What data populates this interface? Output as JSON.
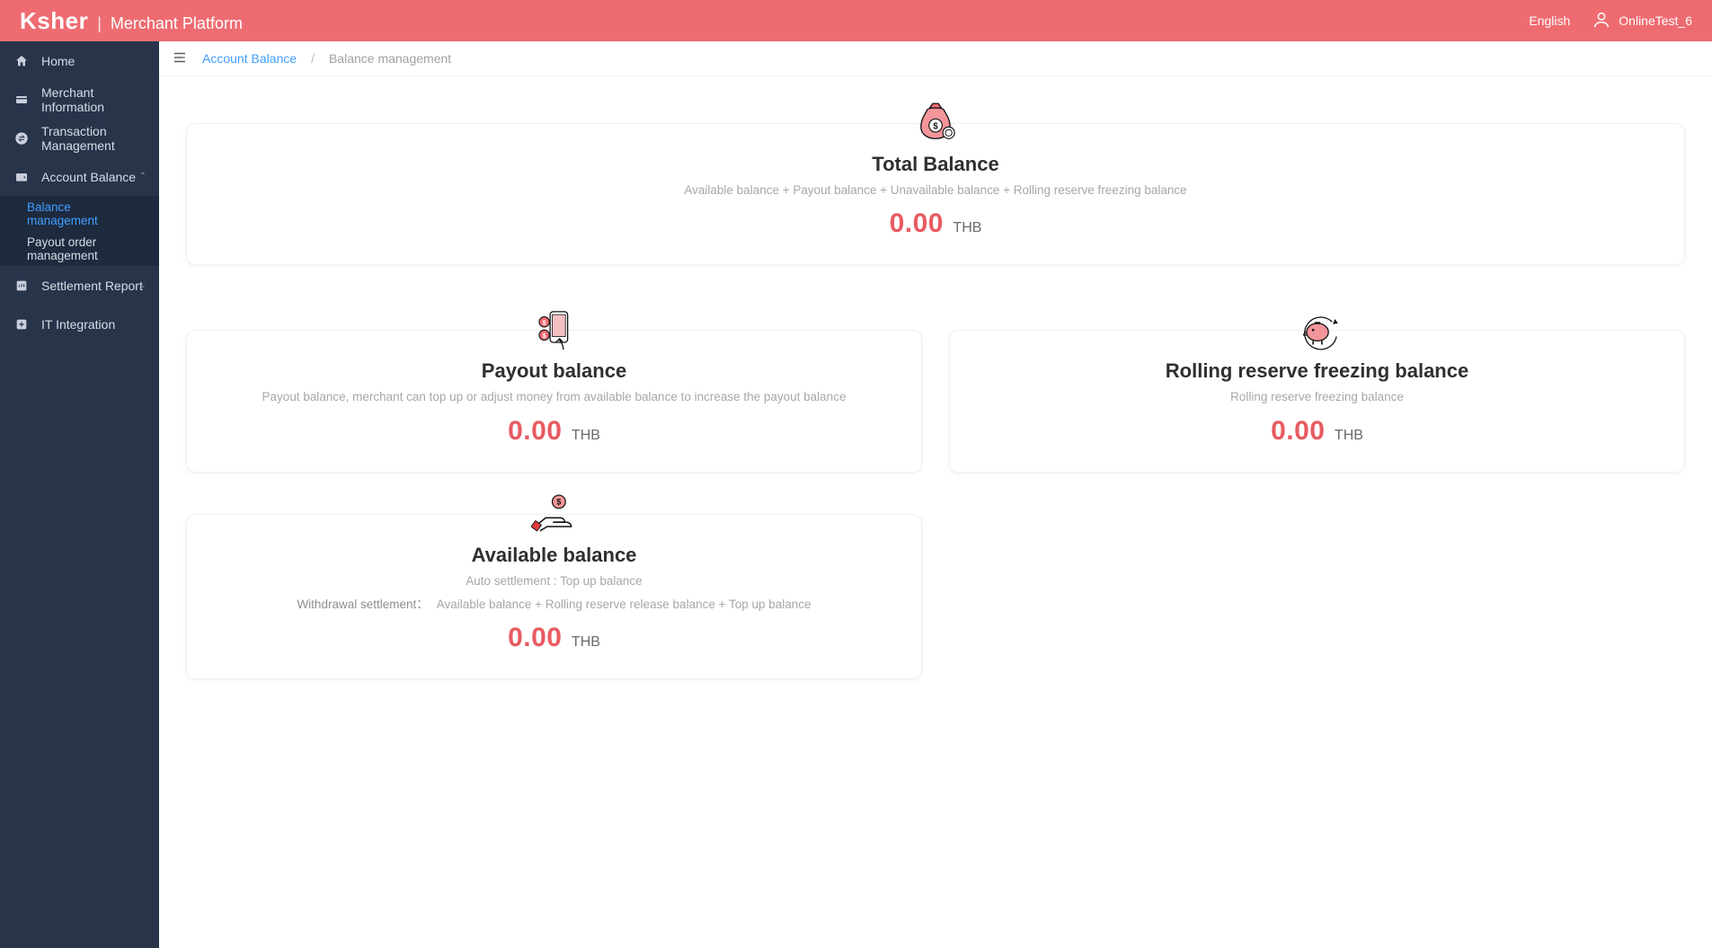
{
  "colors": {
    "accent": "#ee6c71",
    "sidebar": "#27344a",
    "link": "#409eff"
  },
  "header": {
    "brand_name": "Ksher",
    "brand_sep": "|",
    "brand_sub": "Merchant Platform",
    "language": "English",
    "username": "OnlineTest_6"
  },
  "sidebar": {
    "items": [
      {
        "label": "Home",
        "icon": "home-icon"
      },
      {
        "label": "Merchant Information",
        "icon": "card-icon"
      },
      {
        "label": "Transaction Management",
        "icon": "swap-icon"
      },
      {
        "label": "Account Balance",
        "icon": "wallet-icon",
        "expanded": true,
        "children": [
          {
            "label": "Balance management",
            "active": true
          },
          {
            "label": "Payout order management"
          }
        ]
      },
      {
        "label": "Settlement Report",
        "icon": "report-icon",
        "expandable": true
      },
      {
        "label": "IT Integration",
        "icon": "plus-box-icon"
      }
    ]
  },
  "breadcrumb": {
    "parent": "Account Balance",
    "sep": "/",
    "current": "Balance management"
  },
  "cards": {
    "total": {
      "title": "Total Balance",
      "desc": "Available balance + Payout balance + Unavailable balance + Rolling reserve freezing balance",
      "amount": "0.00",
      "currency": "THB"
    },
    "payout": {
      "title": "Payout balance",
      "desc": "Payout balance, merchant can top up or adjust money from available balance to increase the payout balance",
      "amount": "0.00",
      "currency": "THB"
    },
    "rolling": {
      "title": "Rolling reserve freezing balance",
      "desc": "Rolling reserve freezing balance",
      "amount": "0.00",
      "currency": "THB"
    },
    "available": {
      "title": "Available balance",
      "desc1": "Auto settlement : Top up balance",
      "desc2_label": "Withdrawal settlement：",
      "desc2_value": "Available balance + Rolling reserve release balance + Top up balance",
      "amount": "0.00",
      "currency": "THB"
    }
  }
}
